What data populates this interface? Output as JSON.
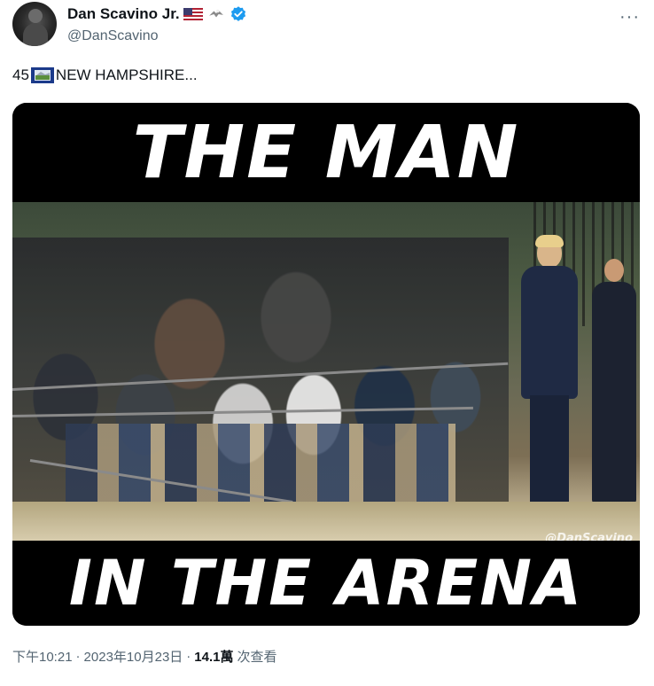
{
  "author": {
    "display_name": "Dan Scavino Jr.",
    "handle": "@DanScavino",
    "badges": [
      "us-flag-icon",
      "eagle-icon",
      "verified-badge-icon"
    ],
    "verified_color": "#1d9bf0"
  },
  "more_options_label": "···",
  "tweet": {
    "text_prefix": "45",
    "text_emoji": "new-hampshire-flag-icon",
    "text_suffix": "NEW HAMPSHIRE..."
  },
  "media": {
    "headline_top": "THE MAN",
    "headline_bottom": "IN THE ARENA",
    "watermark": "@DanScavino"
  },
  "meta": {
    "time": "下午10:21",
    "date": "2023年10月23日",
    "separator": "·",
    "views_count": "14.1萬",
    "views_label": "次查看"
  }
}
